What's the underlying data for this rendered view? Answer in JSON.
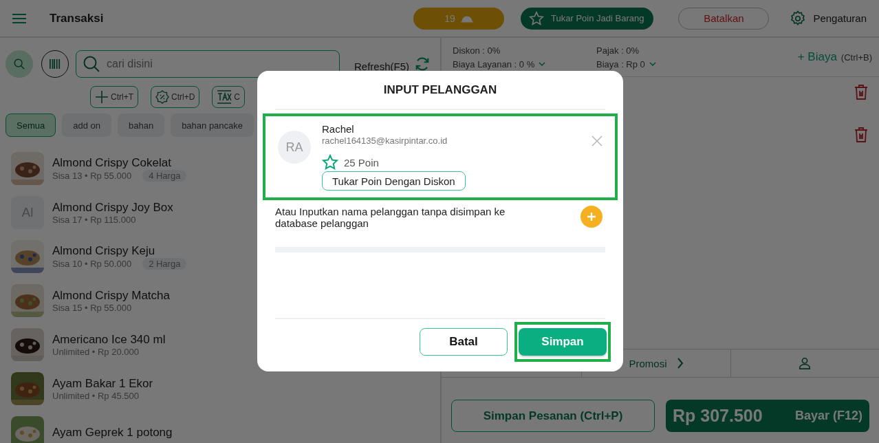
{
  "topbar": {
    "title": "Transaksi",
    "queue_count": "19",
    "redeem_button": "Tukar Poin Jadi Barang",
    "cancel_button": "Batalkan",
    "settings": "Pengaturan"
  },
  "toolbar": {
    "search": {
      "placeholder": "cari disini"
    },
    "refresh": "Refresh(F5)",
    "shortcuts": [
      {
        "kind": "add",
        "label": "Ctrl+T"
      },
      {
        "kind": "discount",
        "label": "Ctrl+D"
      },
      {
        "kind": "tax",
        "label": "C"
      }
    ]
  },
  "categories": [
    {
      "label": "Semua",
      "selected": true
    },
    {
      "label": "add on",
      "selected": false
    },
    {
      "label": "bahan",
      "selected": false
    },
    {
      "label": "bahan pancake",
      "selected": false
    }
  ],
  "products": [
    {
      "name": "Almond Crispy Cokelat",
      "detail": "Sisa 13 • Rp 55.000",
      "badge": "4 Harga",
      "kind": "picture"
    },
    {
      "name": "Almond Crispy Joy Box",
      "detail": "Sisa 17 • Rp 115.000",
      "initials": "Al",
      "kind": "initials"
    },
    {
      "name": "Almond Crispy Keju",
      "detail": "Sisa 10 • Rp 50.000",
      "badge": "2 Harga",
      "kind": "picture"
    },
    {
      "name": "Almond Crispy Matcha",
      "detail": "Sisa 15 • Rp 55.000",
      "kind": "picture"
    },
    {
      "name": "Americano Ice 340 ml",
      "detail": "Unlimited • Rp 20.000",
      "kind": "picture"
    },
    {
      "name": "Ayam Bakar  1 Ekor",
      "detail": "Unlimited • Rp 45.500",
      "kind": "picture"
    },
    {
      "name": "Ayam Geprek 1 potong",
      "kind": "picture"
    }
  ],
  "summary": {
    "discount": "Diskon : 0%",
    "service_fee": "Biaya Layanan : 0 %",
    "tax": "Pajak : 0%",
    "fee": "Biaya : Rp 0",
    "add_fee": "+ Biaya",
    "add_fee_shortcut": "(Ctrl+B)"
  },
  "bottom_tabs": {
    "promo": "Promosi"
  },
  "footer": {
    "save_order": "Simpan Pesanan (Ctrl+P)",
    "total": "Rp 307.500",
    "pay": "Bayar (F12)"
  },
  "dialog": {
    "title": "INPUT PELANGGAN",
    "customer": {
      "initials": "RA",
      "name": "Rachel",
      "email": "rachel164135@kasirpintar.co.id",
      "points": "25 Poin",
      "redeem_button": "Tukar Poin Dengan Diskon",
      "highlighted": true
    },
    "hint": "Atau Inputkan nama pelanggan tanpa disimpan ke database pelanggan",
    "buttons": [
      {
        "kind": "secondary",
        "label": "Batal",
        "highlighted": false
      },
      {
        "kind": "primary",
        "label": "Simpan",
        "highlighted": true
      }
    ]
  }
}
